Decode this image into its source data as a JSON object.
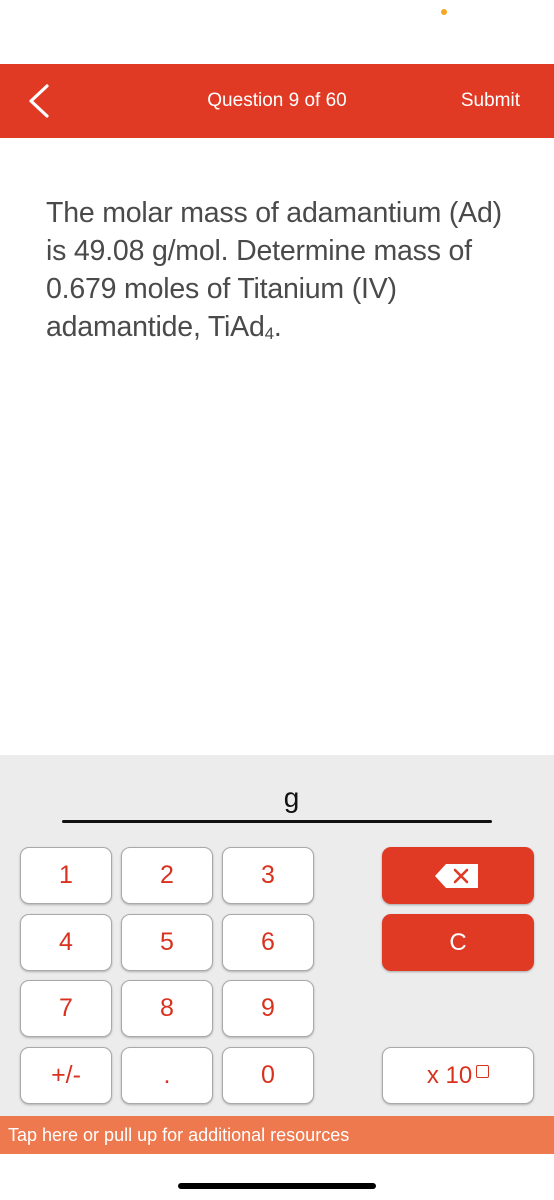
{
  "colors": {
    "brand_red": "#E03A25",
    "key_text": "#D8321F",
    "resources_orange": "#EE794E",
    "status_dot": "#F5A623"
  },
  "status_bar": {
    "indicator": "orange-dot"
  },
  "header": {
    "back_icon": "chevron-left-icon",
    "title": "Question 9 of 60",
    "submit_label": "Submit"
  },
  "question": {
    "text_before_sub": "The molar mass of adamantium (Ad) is 49.08 g/mol. Determine mass of 0.679 moles of Titanium (IV) adamantide, TiAd",
    "subscript": "4",
    "text_after_sub": "."
  },
  "answer": {
    "value": "",
    "unit": "g"
  },
  "keypad": {
    "keys": [
      {
        "label": "1"
      },
      {
        "label": "2"
      },
      {
        "label": "3"
      },
      {
        "label": "4"
      },
      {
        "label": "5"
      },
      {
        "label": "6"
      },
      {
        "label": "7"
      },
      {
        "label": "8"
      },
      {
        "label": "9"
      },
      {
        "label": "+/-"
      },
      {
        "label": "."
      },
      {
        "label": "0"
      }
    ],
    "backspace_icon": "backspace-icon",
    "clear_label": "C",
    "sci_label": "x 10"
  },
  "resources": {
    "label": "Tap here or pull up for additional resources"
  }
}
